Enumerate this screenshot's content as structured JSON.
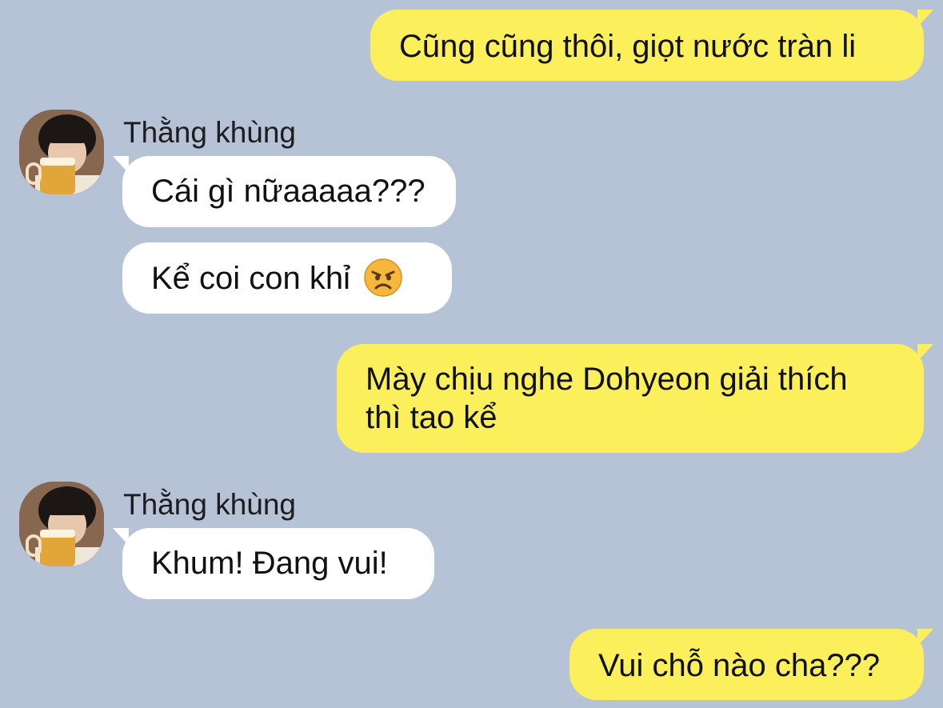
{
  "colors": {
    "background": "#b6c3d6",
    "outgoing_bubble": "#fbef5c",
    "incoming_bubble": "#ffffff"
  },
  "messages": [
    {
      "direction": "out",
      "text": "Cũng cũng thôi, giọt nước tràn li"
    },
    {
      "direction": "in",
      "sender": "Thằng khùng",
      "text": "Cái gì nữaaaaa???"
    },
    {
      "direction": "in",
      "text": "Kể coi con khỉ",
      "emoji": "angry-face-icon"
    },
    {
      "direction": "out",
      "line1": "Mày chịu nghe Dohyeon giải thích",
      "line2": "thì tao kể"
    },
    {
      "direction": "in",
      "sender": "Thằng khùng",
      "text": "Khum! Đang vui!"
    },
    {
      "direction": "out",
      "text": "Vui chỗ nào cha???"
    }
  ]
}
